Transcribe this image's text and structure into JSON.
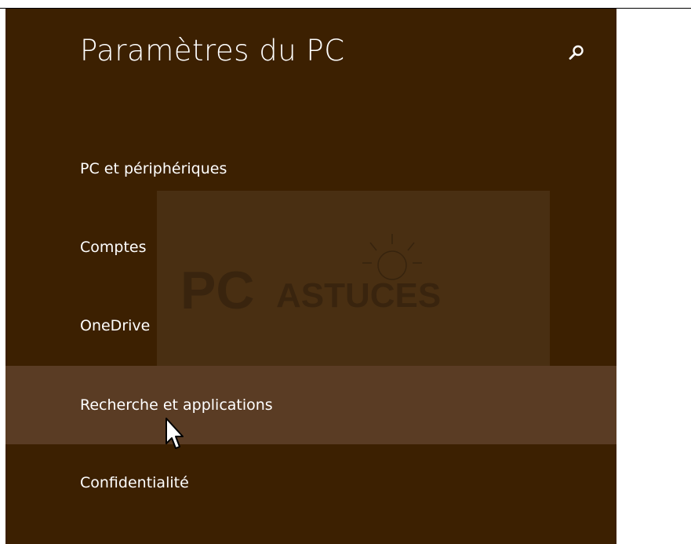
{
  "header": {
    "title": "Paramètres du PC",
    "search_icon": "search-icon"
  },
  "menu": {
    "items": [
      {
        "label": "PC et périphériques"
      },
      {
        "label": "Comptes"
      },
      {
        "label": "OneDrive"
      },
      {
        "label": "Recherche et applications",
        "selected": true
      },
      {
        "label": "Confidentialité"
      }
    ]
  },
  "watermark": {
    "text": "PC ASTUCES"
  },
  "colors": {
    "panel_bg": "#3c2001",
    "selected_bg": "#5a3c24",
    "text": "#ffffff",
    "page_bg": "#ffffff"
  }
}
